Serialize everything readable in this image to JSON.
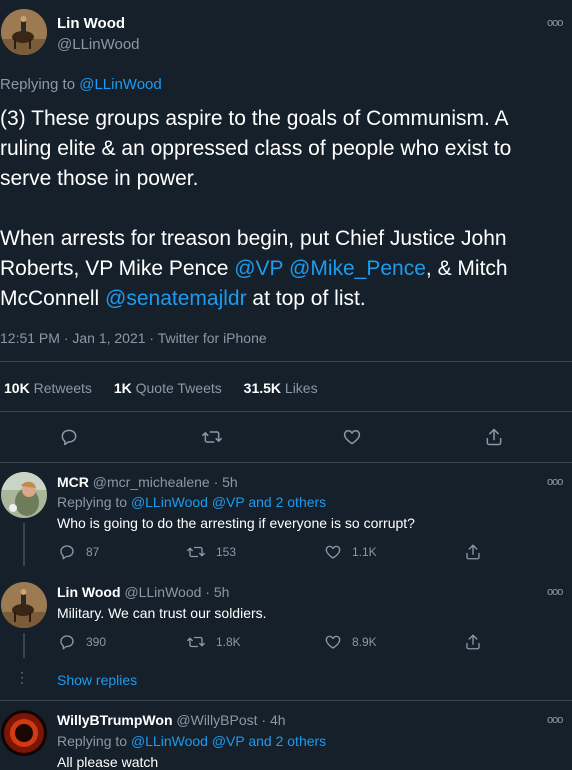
{
  "main_tweet": {
    "name": "Lin Wood",
    "handle": "@LLinWood",
    "replying_prefix": "Replying to ",
    "replying_to": "@LLinWood",
    "lines": [
      [
        {
          "t": "(3) These groups aspire to the goals of Communism. A"
        }
      ],
      [
        {
          "t": "ruling elite & an oppressed class of people who exist to"
        }
      ],
      [
        {
          "t": "serve those in power."
        }
      ],
      [],
      [
        {
          "t": "When arrests for treason begin, put Chief Justice John"
        }
      ],
      [
        {
          "t": "Roberts, VP Mike Pence "
        },
        {
          "t": "@VP",
          "link": true
        },
        {
          "t": " "
        },
        {
          "t": "@Mike_Pence",
          "link": true
        },
        {
          "t": ", & Mitch"
        }
      ],
      [
        {
          "t": "McConnell "
        },
        {
          "t": "@senatemajldr",
          "link": true
        },
        {
          "t": " at top of list."
        }
      ]
    ],
    "timestamp": "12:51 PM · Jan 1, 2021 · Twitter for iPhone",
    "stats": {
      "retweets_count": "10K",
      "retweets_label": "Retweets",
      "quotes_count": "1K",
      "quotes_label": "Quote Tweets",
      "likes_count": "31.5K",
      "likes_label": "Likes"
    }
  },
  "replies": [
    {
      "name": "MCR",
      "handle": "@mcr_michealene",
      "time": "· 5h",
      "replying_prefix": "Replying to ",
      "replying_links": "@LLinWood @VP and 2 others",
      "text": "Who is going to do the arresting if everyone is so corrupt?",
      "counts": {
        "reply": "87",
        "retweet": "153",
        "like": "1.1K"
      }
    },
    {
      "name": "Lin Wood",
      "handle": "@LLinWood",
      "time": "· 5h",
      "text": "Military. We can trust our soldiers.",
      "counts": {
        "reply": "390",
        "retweet": "1.8K",
        "like": "8.9K"
      }
    },
    {
      "name": "WillyBTrumpWon",
      "handle": "@WillyBPost",
      "time": "· 4h",
      "replying_prefix": "Replying to ",
      "replying_links": "@LLinWood @VP and 2 others",
      "text": "All please watch"
    }
  ],
  "show_replies": "Show replies",
  "more_glyph": "ooo",
  "colors": {
    "background": "#15202b",
    "link": "#1d9bf0",
    "muted": "#8b98a5",
    "divider": "#38444d"
  }
}
